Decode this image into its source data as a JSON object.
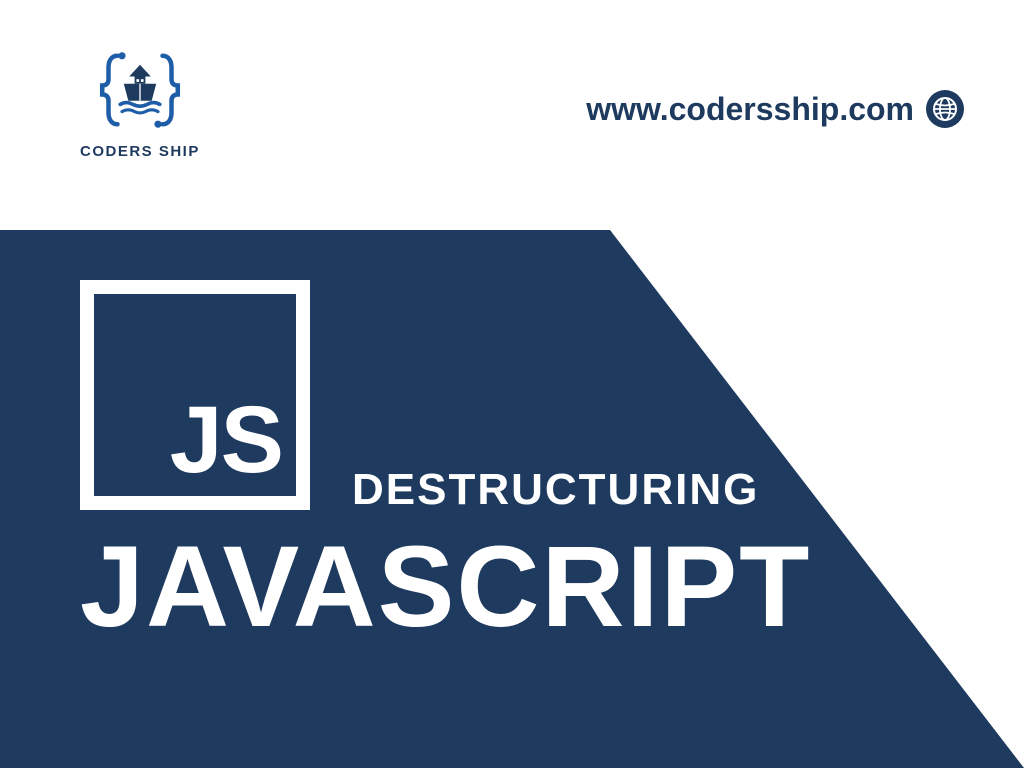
{
  "brand": {
    "name": "CODERS SHIP",
    "url": "www.codersship.com"
  },
  "banner": {
    "badge_text": "JS",
    "subtitle": "DESTRUCTURING",
    "title": "JAVASCRIPT"
  },
  "colors": {
    "primary": "#1e3a5f",
    "background": "#ffffff"
  }
}
